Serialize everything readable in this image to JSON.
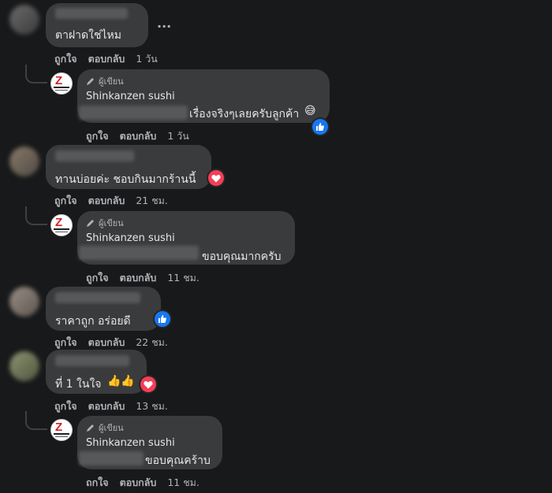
{
  "author_badge": "ผู้เขียน",
  "page_name": "Shinkanzen sushi",
  "more_options": "...",
  "emoji_sweat": "😅",
  "emoji_thumbs": "👍👍",
  "comments": [
    {
      "text": "ตาฝาดใช่ไหม",
      "actions": {
        "like": "ถูกใจ",
        "reply": "ตอบกลับ",
        "time": "1 วัน"
      },
      "reply": {
        "text": "เรื่องจริงๆเลยครับลูกค้า",
        "reaction": "like-icon",
        "actions": {
          "like": "ถูกใจ",
          "reply": "ตอบกลับ",
          "time": "1 วัน"
        }
      }
    },
    {
      "text": "ทานบ่อยค่ะ ชอบกินมากร้านนี้",
      "reaction": "love-icon",
      "actions": {
        "like": "ถูกใจ",
        "reply": "ตอบกลับ",
        "time": "21 ชม."
      },
      "reply": {
        "text": "ขอบคุณมากครับ",
        "actions": {
          "like": "ถูกใจ",
          "reply": "ตอบกลับ",
          "time": "11 ชม."
        }
      }
    },
    {
      "text": "ราคาถูก อร่อยดี",
      "reaction": "like-icon",
      "actions": {
        "like": "ถูกใจ",
        "reply": "ตอบกลับ",
        "time": "22 ชม."
      }
    },
    {
      "text": "ที่ 1 ในใจ",
      "reaction": "love-icon",
      "actions": {
        "like": "ถูกใจ",
        "reply": "ตอบกลับ",
        "time": "13 ชม."
      },
      "reply": {
        "text": "ขอบคุณคร้าบ",
        "actions": {
          "like": "ถกใจ",
          "reply": "ตอบกลับ",
          "time": "11 ชม."
        }
      }
    }
  ],
  "colors": {
    "background": "#18191a",
    "bubble": "#3a3b3c",
    "like": "#1877f2",
    "love": "#f33e58",
    "muted": "#b0b3b8"
  }
}
